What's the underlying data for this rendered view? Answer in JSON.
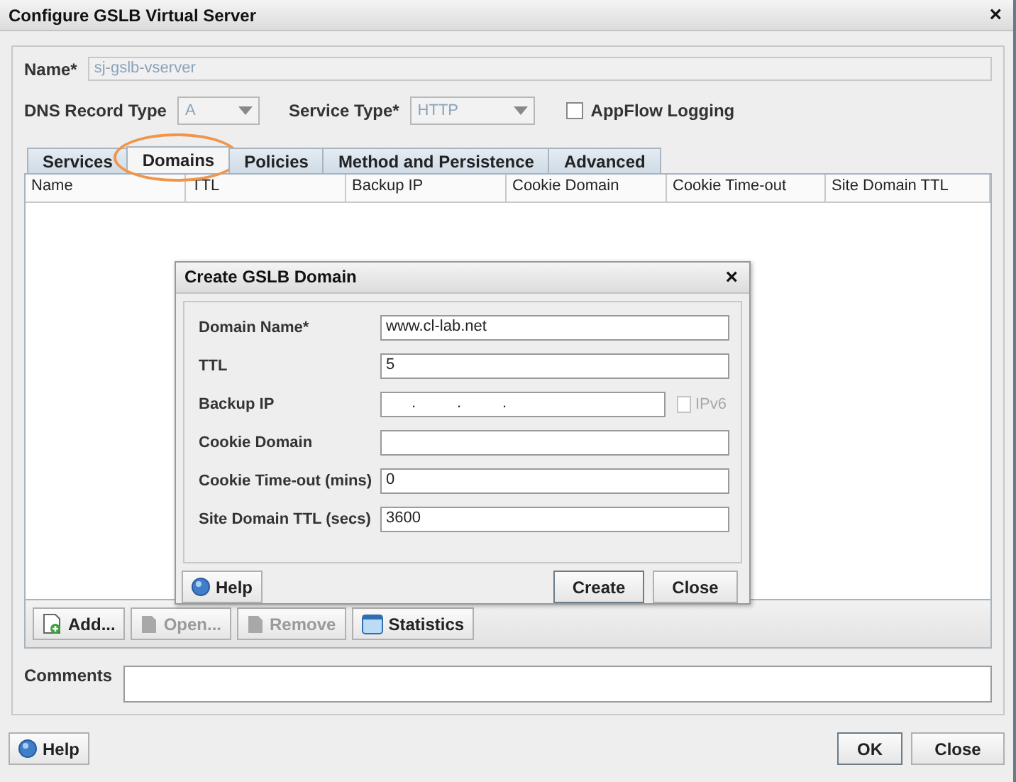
{
  "window": {
    "title": "Configure GSLB Virtual Server",
    "close": "×"
  },
  "name_field": {
    "label": "Name*",
    "value": "sj-gslb-vserver",
    "disabled": true
  },
  "dns_record_type": {
    "label": "DNS Record Type",
    "value": "A",
    "disabled": true
  },
  "service_type": {
    "label": "Service Type*",
    "value": "HTTP",
    "disabled": true
  },
  "appflow_logging": {
    "label": "AppFlow Logging",
    "checked": false
  },
  "tabs": [
    {
      "label": "Services",
      "selected": false,
      "highlighted": false
    },
    {
      "label": "Domains",
      "selected": true,
      "highlighted": true
    },
    {
      "label": "Policies",
      "selected": false,
      "highlighted": false
    },
    {
      "label": "Method and Persistence",
      "selected": false,
      "highlighted": false
    },
    {
      "label": "Advanced",
      "selected": false,
      "highlighted": false
    }
  ],
  "table": {
    "columns": [
      "Name",
      "TTL",
      "Backup IP",
      "Cookie Domain",
      "Cookie Time-out",
      "Site Domain TTL"
    ]
  },
  "toolbar": [
    {
      "label": "Add...",
      "disabled": false
    },
    {
      "label": "Open...",
      "disabled": true
    },
    {
      "label": "Remove",
      "disabled": true
    },
    {
      "label": "Statistics",
      "disabled": false
    }
  ],
  "comments": {
    "label": "Comments"
  },
  "help_button": {
    "label": "Help"
  },
  "buttons": [
    {
      "label": "OK",
      "default": true
    },
    {
      "label": "Close",
      "default": false
    }
  ],
  "dialog": {
    "title": "Create GSLB Domain",
    "close": "×",
    "fields": [
      {
        "kind": "text",
        "label": "Domain Name*",
        "value": "www.cl-lab.net"
      },
      {
        "kind": "text",
        "label": "TTL",
        "value": "5"
      },
      {
        "kind": "ip",
        "label": "Backup IP",
        "separator": ".",
        "ipv6": {
          "label": "IPv6",
          "checked": false,
          "disabled": true
        }
      },
      {
        "kind": "text",
        "label": "Cookie Domain"
      },
      {
        "kind": "text",
        "label": "Cookie Time-out (mins)",
        "value": "0"
      },
      {
        "kind": "text",
        "label": "Site Domain TTL (secs)",
        "value": "3600"
      }
    ],
    "help_button": {
      "label": "Help"
    },
    "buttons": [
      {
        "label": "Create",
        "default": true
      },
      {
        "label": "Close",
        "default": false
      }
    ]
  }
}
